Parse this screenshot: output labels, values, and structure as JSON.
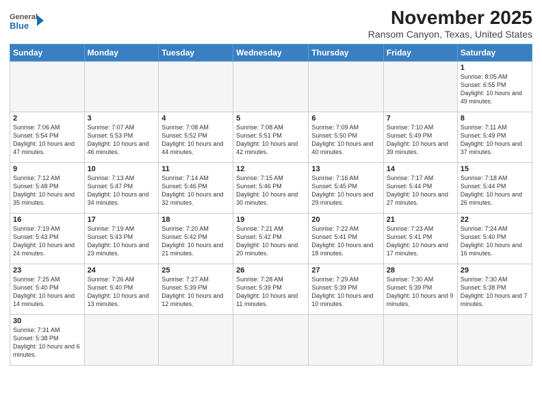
{
  "logo": {
    "line1": "General",
    "line2": "Blue"
  },
  "title": "November 2025",
  "subtitle": "Ransom Canyon, Texas, United States",
  "days_of_week": [
    "Sunday",
    "Monday",
    "Tuesday",
    "Wednesday",
    "Thursday",
    "Friday",
    "Saturday"
  ],
  "weeks": [
    [
      {
        "day": "",
        "info": ""
      },
      {
        "day": "",
        "info": ""
      },
      {
        "day": "",
        "info": ""
      },
      {
        "day": "",
        "info": ""
      },
      {
        "day": "",
        "info": ""
      },
      {
        "day": "",
        "info": ""
      },
      {
        "day": "1",
        "info": "Sunrise: 8:05 AM\nSunset: 6:55 PM\nDaylight: 10 hours and 49 minutes."
      }
    ],
    [
      {
        "day": "2",
        "info": "Sunrise: 7:06 AM\nSunset: 5:54 PM\nDaylight: 10 hours and 47 minutes."
      },
      {
        "day": "3",
        "info": "Sunrise: 7:07 AM\nSunset: 5:53 PM\nDaylight: 10 hours and 46 minutes."
      },
      {
        "day": "4",
        "info": "Sunrise: 7:08 AM\nSunset: 5:52 PM\nDaylight: 10 hours and 44 minutes."
      },
      {
        "day": "5",
        "info": "Sunrise: 7:08 AM\nSunset: 5:51 PM\nDaylight: 10 hours and 42 minutes."
      },
      {
        "day": "6",
        "info": "Sunrise: 7:09 AM\nSunset: 5:50 PM\nDaylight: 10 hours and 40 minutes."
      },
      {
        "day": "7",
        "info": "Sunrise: 7:10 AM\nSunset: 5:49 PM\nDaylight: 10 hours and 39 minutes."
      },
      {
        "day": "8",
        "info": "Sunrise: 7:11 AM\nSunset: 5:49 PM\nDaylight: 10 hours and 37 minutes."
      }
    ],
    [
      {
        "day": "9",
        "info": "Sunrise: 7:12 AM\nSunset: 5:48 PM\nDaylight: 10 hours and 35 minutes."
      },
      {
        "day": "10",
        "info": "Sunrise: 7:13 AM\nSunset: 5:47 PM\nDaylight: 10 hours and 34 minutes."
      },
      {
        "day": "11",
        "info": "Sunrise: 7:14 AM\nSunset: 5:46 PM\nDaylight: 10 hours and 32 minutes."
      },
      {
        "day": "12",
        "info": "Sunrise: 7:15 AM\nSunset: 5:46 PM\nDaylight: 10 hours and 30 minutes."
      },
      {
        "day": "13",
        "info": "Sunrise: 7:16 AM\nSunset: 5:45 PM\nDaylight: 10 hours and 29 minutes."
      },
      {
        "day": "14",
        "info": "Sunrise: 7:17 AM\nSunset: 5:44 PM\nDaylight: 10 hours and 27 minutes."
      },
      {
        "day": "15",
        "info": "Sunrise: 7:18 AM\nSunset: 5:44 PM\nDaylight: 10 hours and 26 minutes."
      }
    ],
    [
      {
        "day": "16",
        "info": "Sunrise: 7:19 AM\nSunset: 5:43 PM\nDaylight: 10 hours and 24 minutes."
      },
      {
        "day": "17",
        "info": "Sunrise: 7:19 AM\nSunset: 5:43 PM\nDaylight: 10 hours and 23 minutes."
      },
      {
        "day": "18",
        "info": "Sunrise: 7:20 AM\nSunset: 5:42 PM\nDaylight: 10 hours and 21 minutes."
      },
      {
        "day": "19",
        "info": "Sunrise: 7:21 AM\nSunset: 5:42 PM\nDaylight: 10 hours and 20 minutes."
      },
      {
        "day": "20",
        "info": "Sunrise: 7:22 AM\nSunset: 5:41 PM\nDaylight: 10 hours and 18 minutes."
      },
      {
        "day": "21",
        "info": "Sunrise: 7:23 AM\nSunset: 5:41 PM\nDaylight: 10 hours and 17 minutes."
      },
      {
        "day": "22",
        "info": "Sunrise: 7:24 AM\nSunset: 5:40 PM\nDaylight: 10 hours and 16 minutes."
      }
    ],
    [
      {
        "day": "23",
        "info": "Sunrise: 7:25 AM\nSunset: 5:40 PM\nDaylight: 10 hours and 14 minutes."
      },
      {
        "day": "24",
        "info": "Sunrise: 7:26 AM\nSunset: 5:40 PM\nDaylight: 10 hours and 13 minutes."
      },
      {
        "day": "25",
        "info": "Sunrise: 7:27 AM\nSunset: 5:39 PM\nDaylight: 10 hours and 12 minutes."
      },
      {
        "day": "26",
        "info": "Sunrise: 7:28 AM\nSunset: 5:39 PM\nDaylight: 10 hours and 11 minutes."
      },
      {
        "day": "27",
        "info": "Sunrise: 7:29 AM\nSunset: 5:39 PM\nDaylight: 10 hours and 10 minutes."
      },
      {
        "day": "28",
        "info": "Sunrise: 7:30 AM\nSunset: 5:39 PM\nDaylight: 10 hours and 9 minutes."
      },
      {
        "day": "29",
        "info": "Sunrise: 7:30 AM\nSunset: 5:38 PM\nDaylight: 10 hours and 7 minutes."
      }
    ],
    [
      {
        "day": "30",
        "info": "Sunrise: 7:31 AM\nSunset: 5:38 PM\nDaylight: 10 hours and 6 minutes."
      },
      {
        "day": "",
        "info": ""
      },
      {
        "day": "",
        "info": ""
      },
      {
        "day": "",
        "info": ""
      },
      {
        "day": "",
        "info": ""
      },
      {
        "day": "",
        "info": ""
      },
      {
        "day": "",
        "info": ""
      }
    ]
  ]
}
